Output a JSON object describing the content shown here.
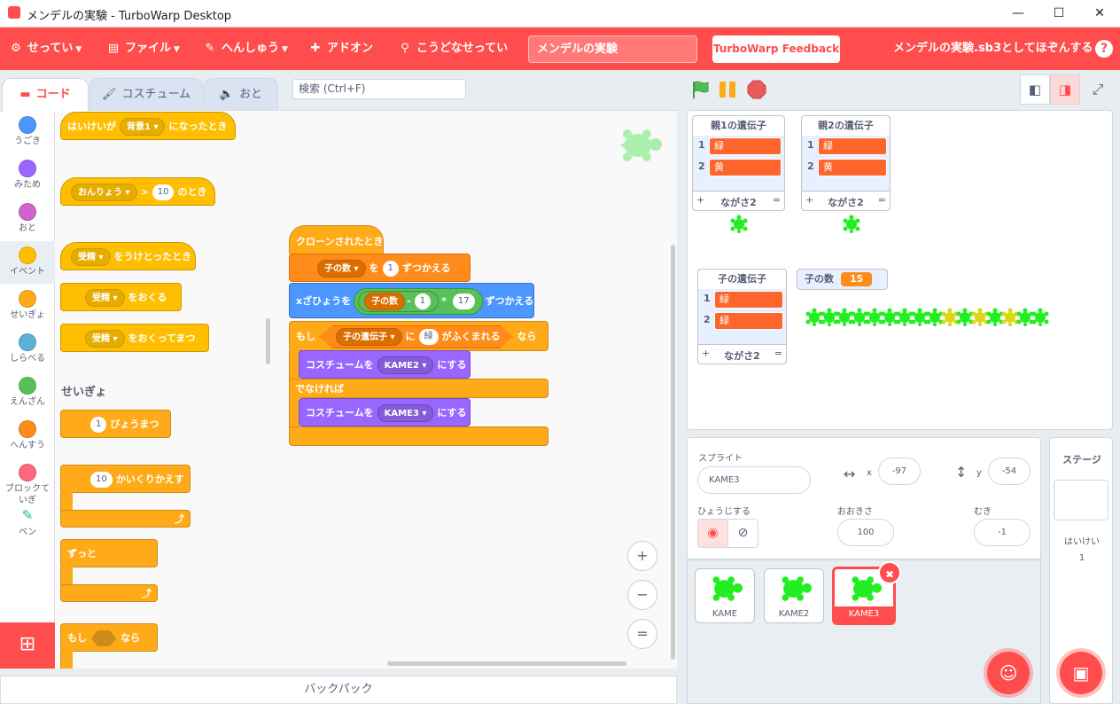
{
  "window": {
    "title": "メンデルの実験 - TurboWarp Desktop",
    "min": "—",
    "max": "☐",
    "close": "✕"
  },
  "menu": {
    "settings": "せってい",
    "file": "ファイル",
    "edit": "へんしゅう",
    "addons": "アドオン",
    "howto": "こうどなせってい",
    "project_title": "メンデルの実験",
    "feedback": "TurboWarp Feedback",
    "save": "メンデルの実験.sb3としてほぞんする",
    "help": "?"
  },
  "tabs": {
    "code": "コード",
    "costume": "コスチューム",
    "sound": "おと"
  },
  "search": {
    "placeholder": "検索 (Ctrl+F)"
  },
  "categories": [
    {
      "label": "うごき",
      "color": "#4c97ff"
    },
    {
      "label": "みため",
      "color": "#9966ff"
    },
    {
      "label": "おと",
      "color": "#cf63cf"
    },
    {
      "label": "イベント",
      "color": "#ffbf00"
    },
    {
      "label": "せいぎょ",
      "color": "#ffab19"
    },
    {
      "label": "しらべる",
      "color": "#5cb1d6"
    },
    {
      "label": "えんざん",
      "color": "#59c059"
    },
    {
      "label": "へんすう",
      "color": "#ff8c1a"
    },
    {
      "label": "ブロックて いぎ",
      "color": "#ff6680"
    },
    {
      "label": "ペン",
      "color": "#0fbd8c"
    }
  ],
  "palette": {
    "b1": {
      "pre": "はいけいが",
      "dd": "背景1",
      "post": "になったとき"
    },
    "b2": {
      "dd": "おんりょう",
      "op": ">",
      "val": "10",
      "post": "のとき"
    },
    "b3": {
      "dd": "受精",
      "post": "をうけとったとき"
    },
    "b4": {
      "dd": "受精",
      "post": "をおくる"
    },
    "b5": {
      "dd": "受精",
      "post": "をおくってまつ"
    },
    "control_header": "せいぎょ",
    "b6": {
      "val": "1",
      "post": "びょうまつ"
    },
    "b7": {
      "val": "10",
      "post": "かいくりかえす"
    },
    "b8": {
      "label": "ずっと"
    },
    "b9": {
      "pre": "もし",
      "post": "なら"
    }
  },
  "script": {
    "hat": "クローンされたとき",
    "set_dd": "子の数",
    "set_mid": "を",
    "set_val": "1",
    "set_post": "ずつかえる",
    "chx_pre": "xざひょうを",
    "chx_var": "子の数",
    "chx_minus": "-",
    "chx_v1": "1",
    "chx_times": "*",
    "chx_v2": "17",
    "chx_post": "ずつかえる",
    "if_pre": "もし",
    "if_list": "子の遺伝子",
    "if_ni": "に",
    "if_item": "緑",
    "if_contains": "がふくまれる",
    "if_post": "なら",
    "cos1_pre": "コスチュームを",
    "cos1_dd": "KAME2",
    "cos1_post": "にする",
    "else": "でなければ",
    "cos2_pre": "コスチュームを",
    "cos2_dd": "KAME3",
    "cos2_post": "にする"
  },
  "zoom": {
    "in": "+",
    "out": "−",
    "reset": "="
  },
  "backpack": "バックパック",
  "stage": {
    "list1": {
      "title": "親1の遺伝子",
      "items": [
        "緑",
        "黄"
      ],
      "length": "ながさ2"
    },
    "list2": {
      "title": "親2の遺伝子",
      "items": [
        "緑",
        "黄"
      ],
      "length": "ながさ2"
    },
    "list3": {
      "title": "子の遺伝子",
      "items": [
        "緑",
        "緑"
      ],
      "length": "ながさ2"
    },
    "var": {
      "name": "子の数",
      "value": "15"
    },
    "row_colors": [
      "green",
      "green",
      "green",
      "green",
      "green",
      "green",
      "green",
      "green",
      "green",
      "yellow",
      "green",
      "yellow",
      "green",
      "yellow",
      "green",
      "green"
    ]
  },
  "sprite": {
    "label": "スプライト",
    "name": "KAME3",
    "x_label": "x",
    "x": "-97",
    "y_label": "y",
    "y": "-54",
    "show_label": "ひょうじする",
    "size_label": "おおきさ",
    "size": "100",
    "dir_label": "むき",
    "dir": "-1"
  },
  "sprites": [
    {
      "name": "KAME"
    },
    {
      "name": "KAME2"
    },
    {
      "name": "KAME3"
    }
  ],
  "stage_pane": {
    "title": "ステージ",
    "backdrops_label": "はいけい",
    "backdrops": "1"
  },
  "colors": {
    "accent": "#ff4c4c",
    "turtle_green": "#22ee22",
    "turtle_yellow": "#d8d816"
  }
}
